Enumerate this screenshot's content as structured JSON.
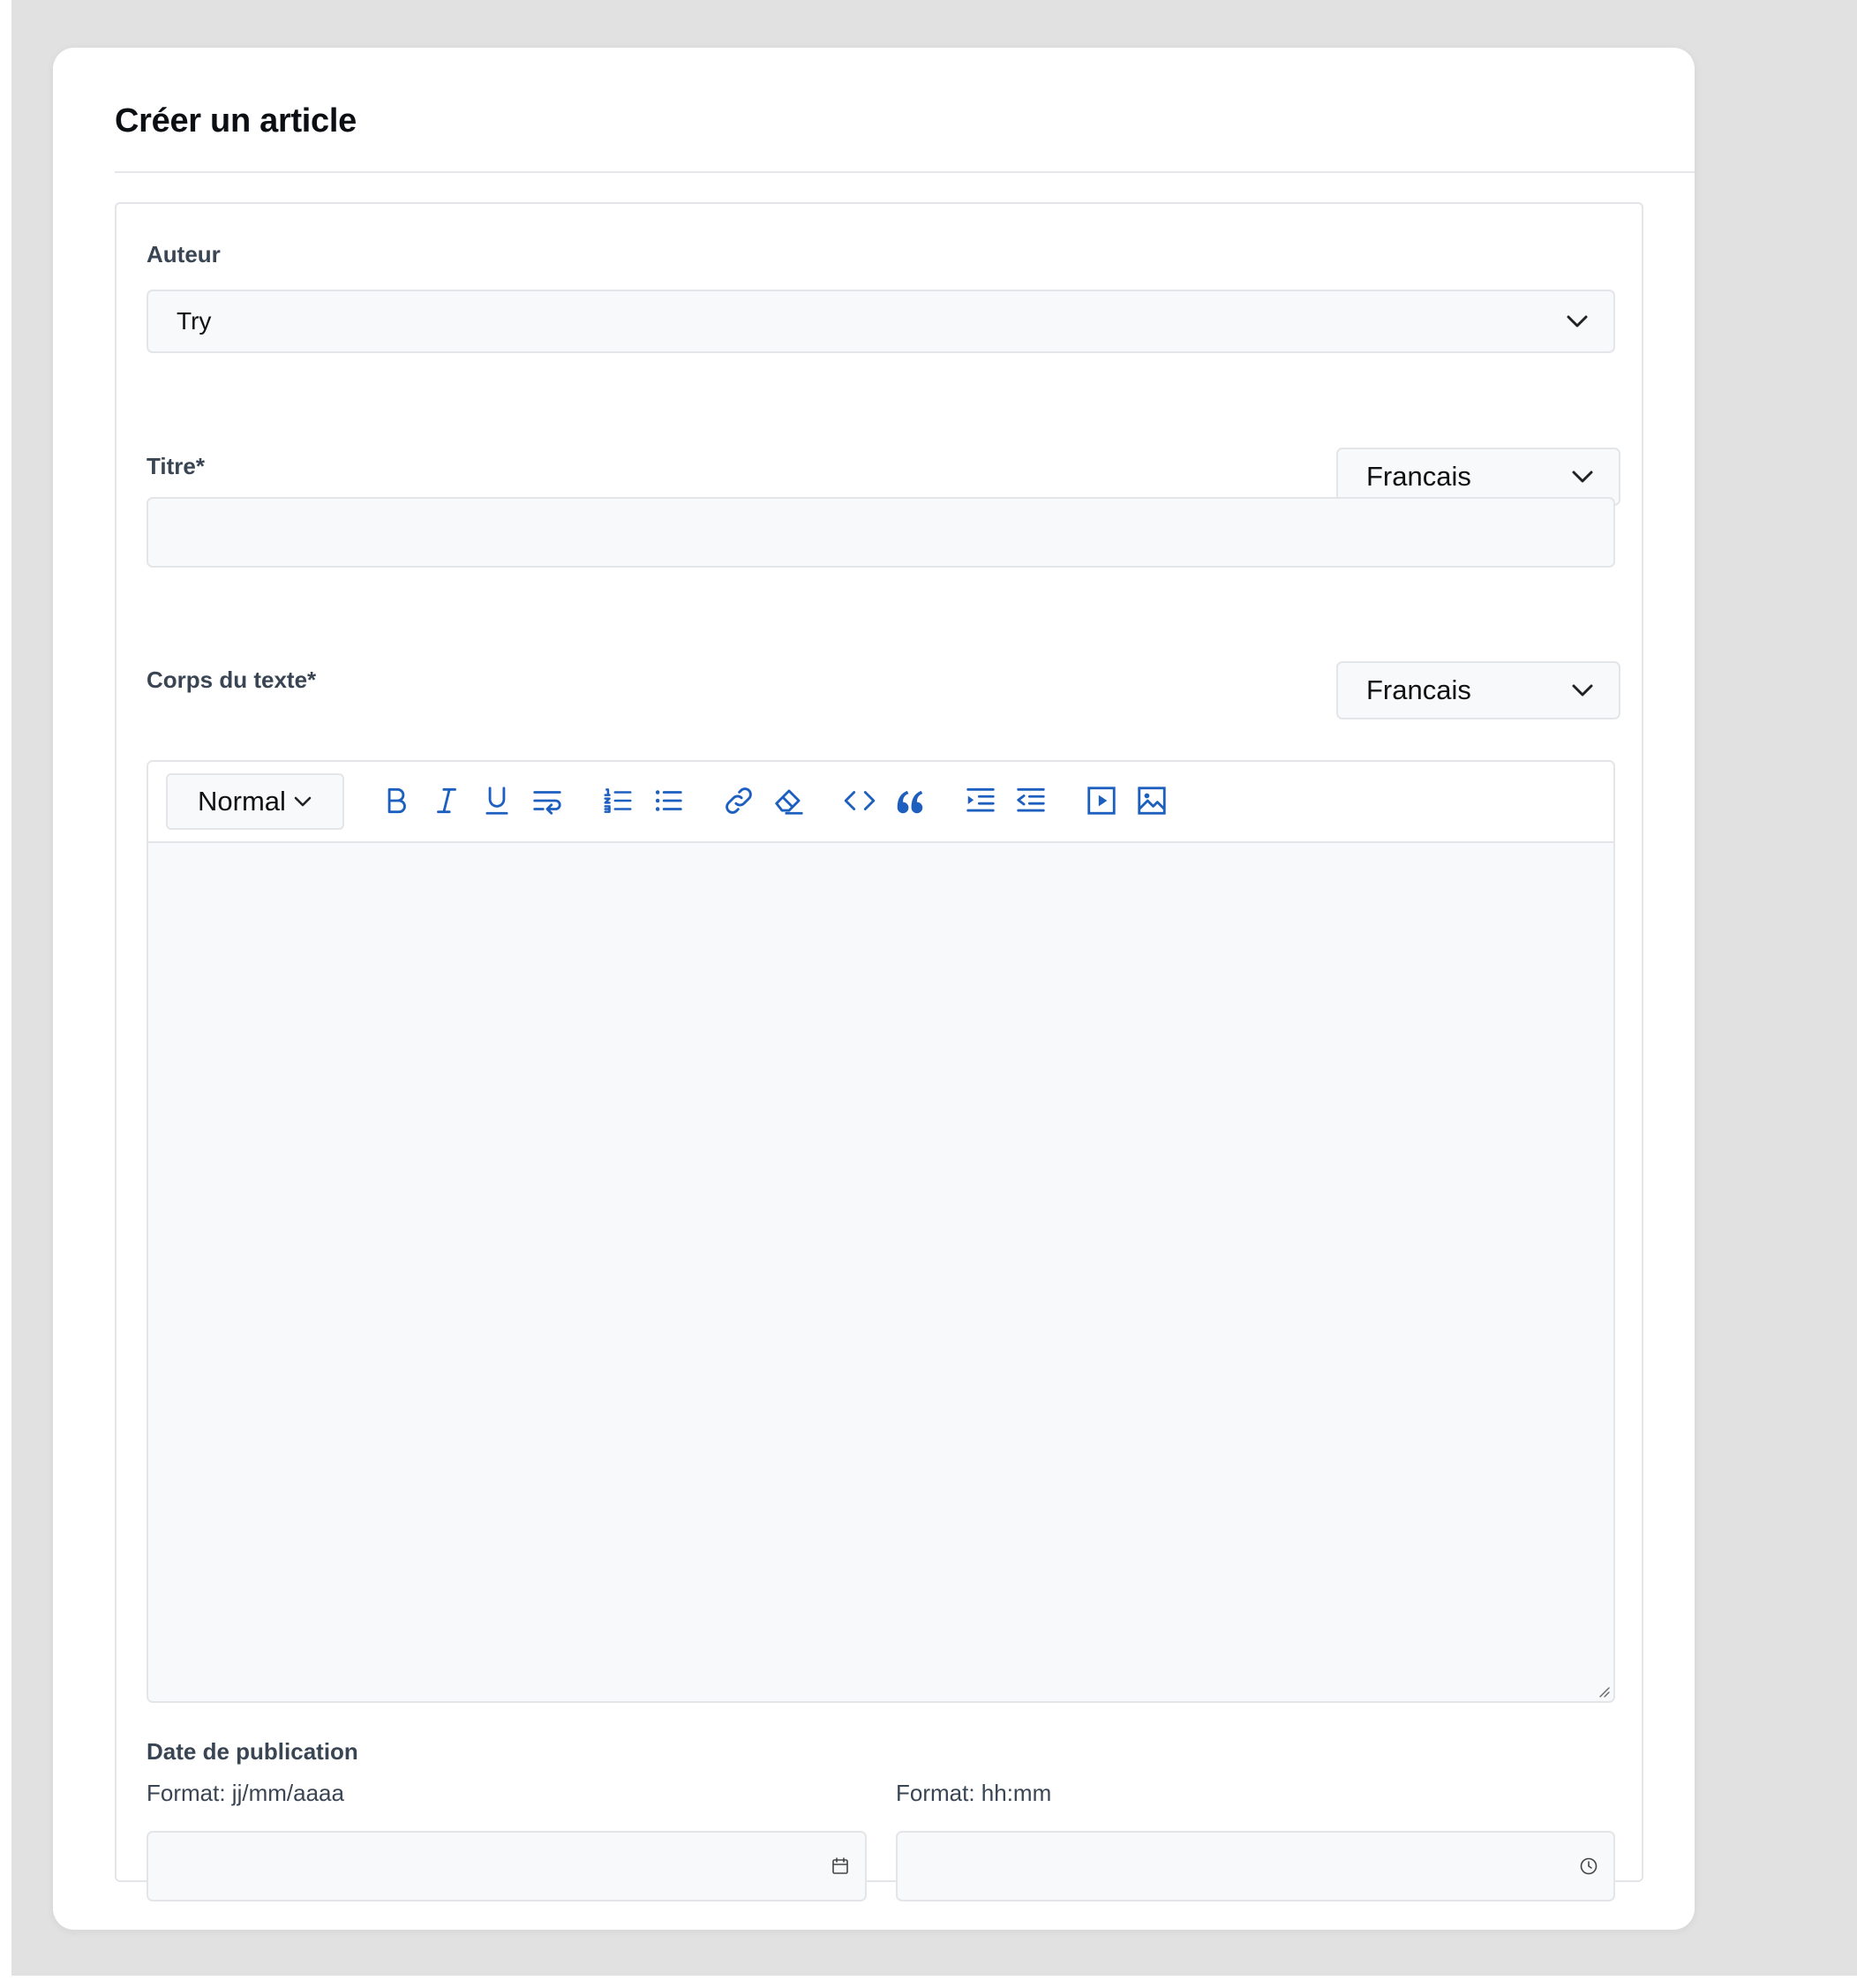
{
  "page": {
    "title": "Créer un article"
  },
  "form": {
    "author": {
      "label": "Auteur",
      "value": "Try"
    },
    "title_field": {
      "label": "Titre*",
      "language": "Francais",
      "value": ""
    },
    "body": {
      "label": "Corps du texte*",
      "language": "Francais",
      "format": "Normal",
      "toolbar": [
        "bold-icon",
        "italic-icon",
        "underline-icon",
        "text-wrap-icon",
        "ordered-list-icon",
        "bullet-list-icon",
        "link-icon",
        "eraser-icon",
        "code-icon",
        "quote-icon",
        "indent-icon",
        "outdent-icon",
        "video-icon",
        "image-icon"
      ]
    },
    "publication": {
      "label": "Date de publication",
      "date_hint": "Format: jj/mm/aaaa",
      "time_hint": "Format: hh:mm",
      "date_value": "",
      "time_value": ""
    }
  },
  "colors": {
    "accent": "#1d5fbf",
    "background": "#e1e1e1",
    "field": "#f8f9fa",
    "border": "#e3e5e8",
    "label": "#3a4553"
  }
}
